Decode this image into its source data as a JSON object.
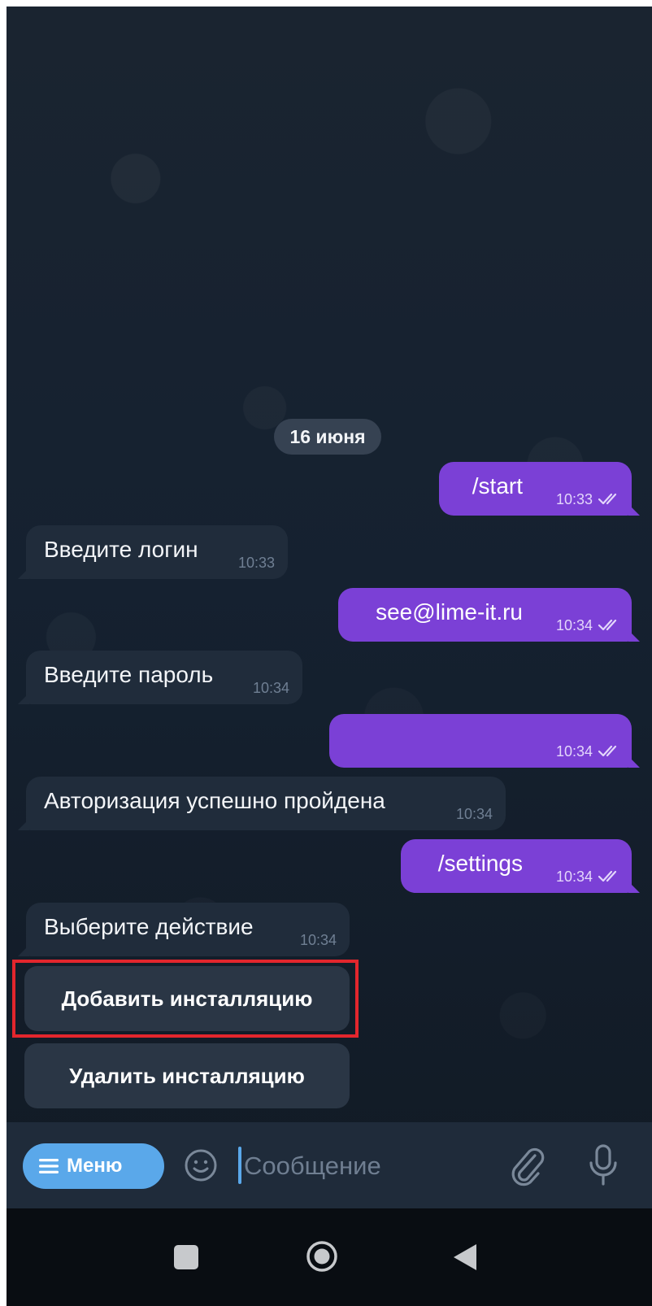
{
  "chat": {
    "date_separator": "16 июня",
    "messages": [
      {
        "direction": "outgoing",
        "text": "/start",
        "time": "10:33",
        "status_icon": "double-check-icon"
      },
      {
        "direction": "incoming",
        "text": "Введите логин",
        "time": "10:33"
      },
      {
        "direction": "outgoing",
        "text": "see@lime-it.ru",
        "time": "10:34",
        "status_icon": "double-check-icon"
      },
      {
        "direction": "incoming",
        "text": "Введите пароль",
        "time": "10:34"
      },
      {
        "direction": "outgoing",
        "text": "",
        "time": "10:34",
        "status_icon": "double-check-icon"
      },
      {
        "direction": "incoming",
        "text": "Авторизация успешно пройдена",
        "time": "10:34"
      },
      {
        "direction": "outgoing",
        "text": "/settings",
        "time": "10:34",
        "status_icon": "double-check-icon"
      },
      {
        "direction": "incoming",
        "text": "Выберите действие",
        "time": "10:34"
      }
    ],
    "keyboard_buttons": [
      {
        "label": "Добавить инсталляцию",
        "highlighted": true
      },
      {
        "label": "Удалить инсталляцию",
        "highlighted": false
      }
    ]
  },
  "input_bar": {
    "menu_label": "Меню",
    "menu_icon": "hamburger-icon",
    "emoji_icon": "smiley-icon",
    "placeholder": "Сообщение",
    "attach_icon": "paperclip-icon",
    "mic_icon": "microphone-icon"
  },
  "system_nav": {
    "recent_icon": "square-icon",
    "home_icon": "circle-icon",
    "back_icon": "triangle-back-icon"
  },
  "colors": {
    "background": "#131d2a",
    "outgoing_bubble": "#7b40d6",
    "incoming_bubble": "#202c3b",
    "keyboard_button": "#2a3645",
    "menu_button": "#5aa8ea",
    "highlight_outline": "#e3262d",
    "nav_bar": "#090d12"
  }
}
